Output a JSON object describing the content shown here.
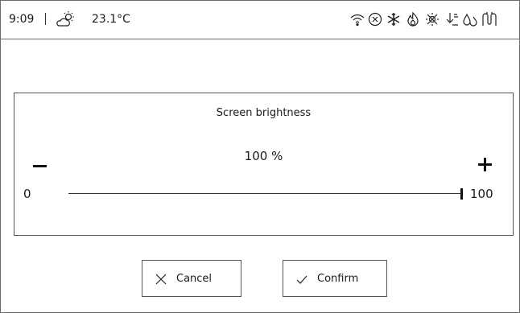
{
  "status_bar": {
    "time": "9:09",
    "temperature": "23.1°C",
    "weather_icon": "partly-sunny-icon",
    "icons": [
      "wifi-icon",
      "circle-x-icon",
      "snowflake-icon",
      "flame-icon",
      "sun-crossed-icon",
      "defrost-arrow-icon",
      "water-drops-icon",
      "heating-coil-icon"
    ]
  },
  "dialog": {
    "title": "Screen brightness",
    "value_text": "100 %",
    "min_label": "0",
    "max_label": "100",
    "slider": {
      "min": 0,
      "max": 100,
      "value": 100
    }
  },
  "buttons": {
    "cancel_label": "Cancel",
    "confirm_label": "Confirm"
  }
}
